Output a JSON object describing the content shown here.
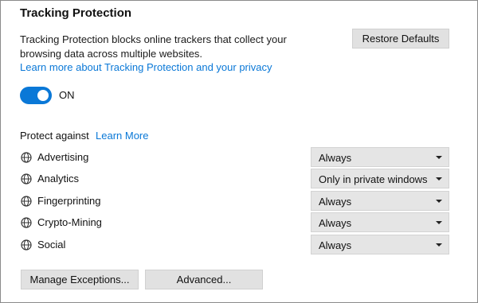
{
  "title": "Tracking Protection",
  "description_lines": [
    "Tracking Protection blocks online trackers that collect your",
    "browsing data across multiple websites."
  ],
  "learn_privacy_link": "Learn more about Tracking Protection and your privacy",
  "restore_defaults_label": "Restore Defaults",
  "toggle": {
    "state": "ON",
    "on": true
  },
  "protect_against_label": "Protect against",
  "learn_more_link": "Learn More",
  "trackers": [
    {
      "label": "Advertising",
      "icon": "globe-icon",
      "value": "Always"
    },
    {
      "label": "Analytics",
      "icon": "globe-icon",
      "value": "Only in private windows"
    },
    {
      "label": "Fingerprinting",
      "icon": "globe-icon",
      "value": "Always"
    },
    {
      "label": "Crypto-Mining",
      "icon": "globe-icon",
      "value": "Always"
    },
    {
      "label": "Social",
      "icon": "globe-icon",
      "value": "Always"
    }
  ],
  "manage_exceptions_label": "Manage Exceptions...",
  "advanced_label": "Advanced...",
  "colors": {
    "accent": "#0a78d7",
    "button_bg": "#e1e1e1",
    "border": "#8a8a8a"
  }
}
